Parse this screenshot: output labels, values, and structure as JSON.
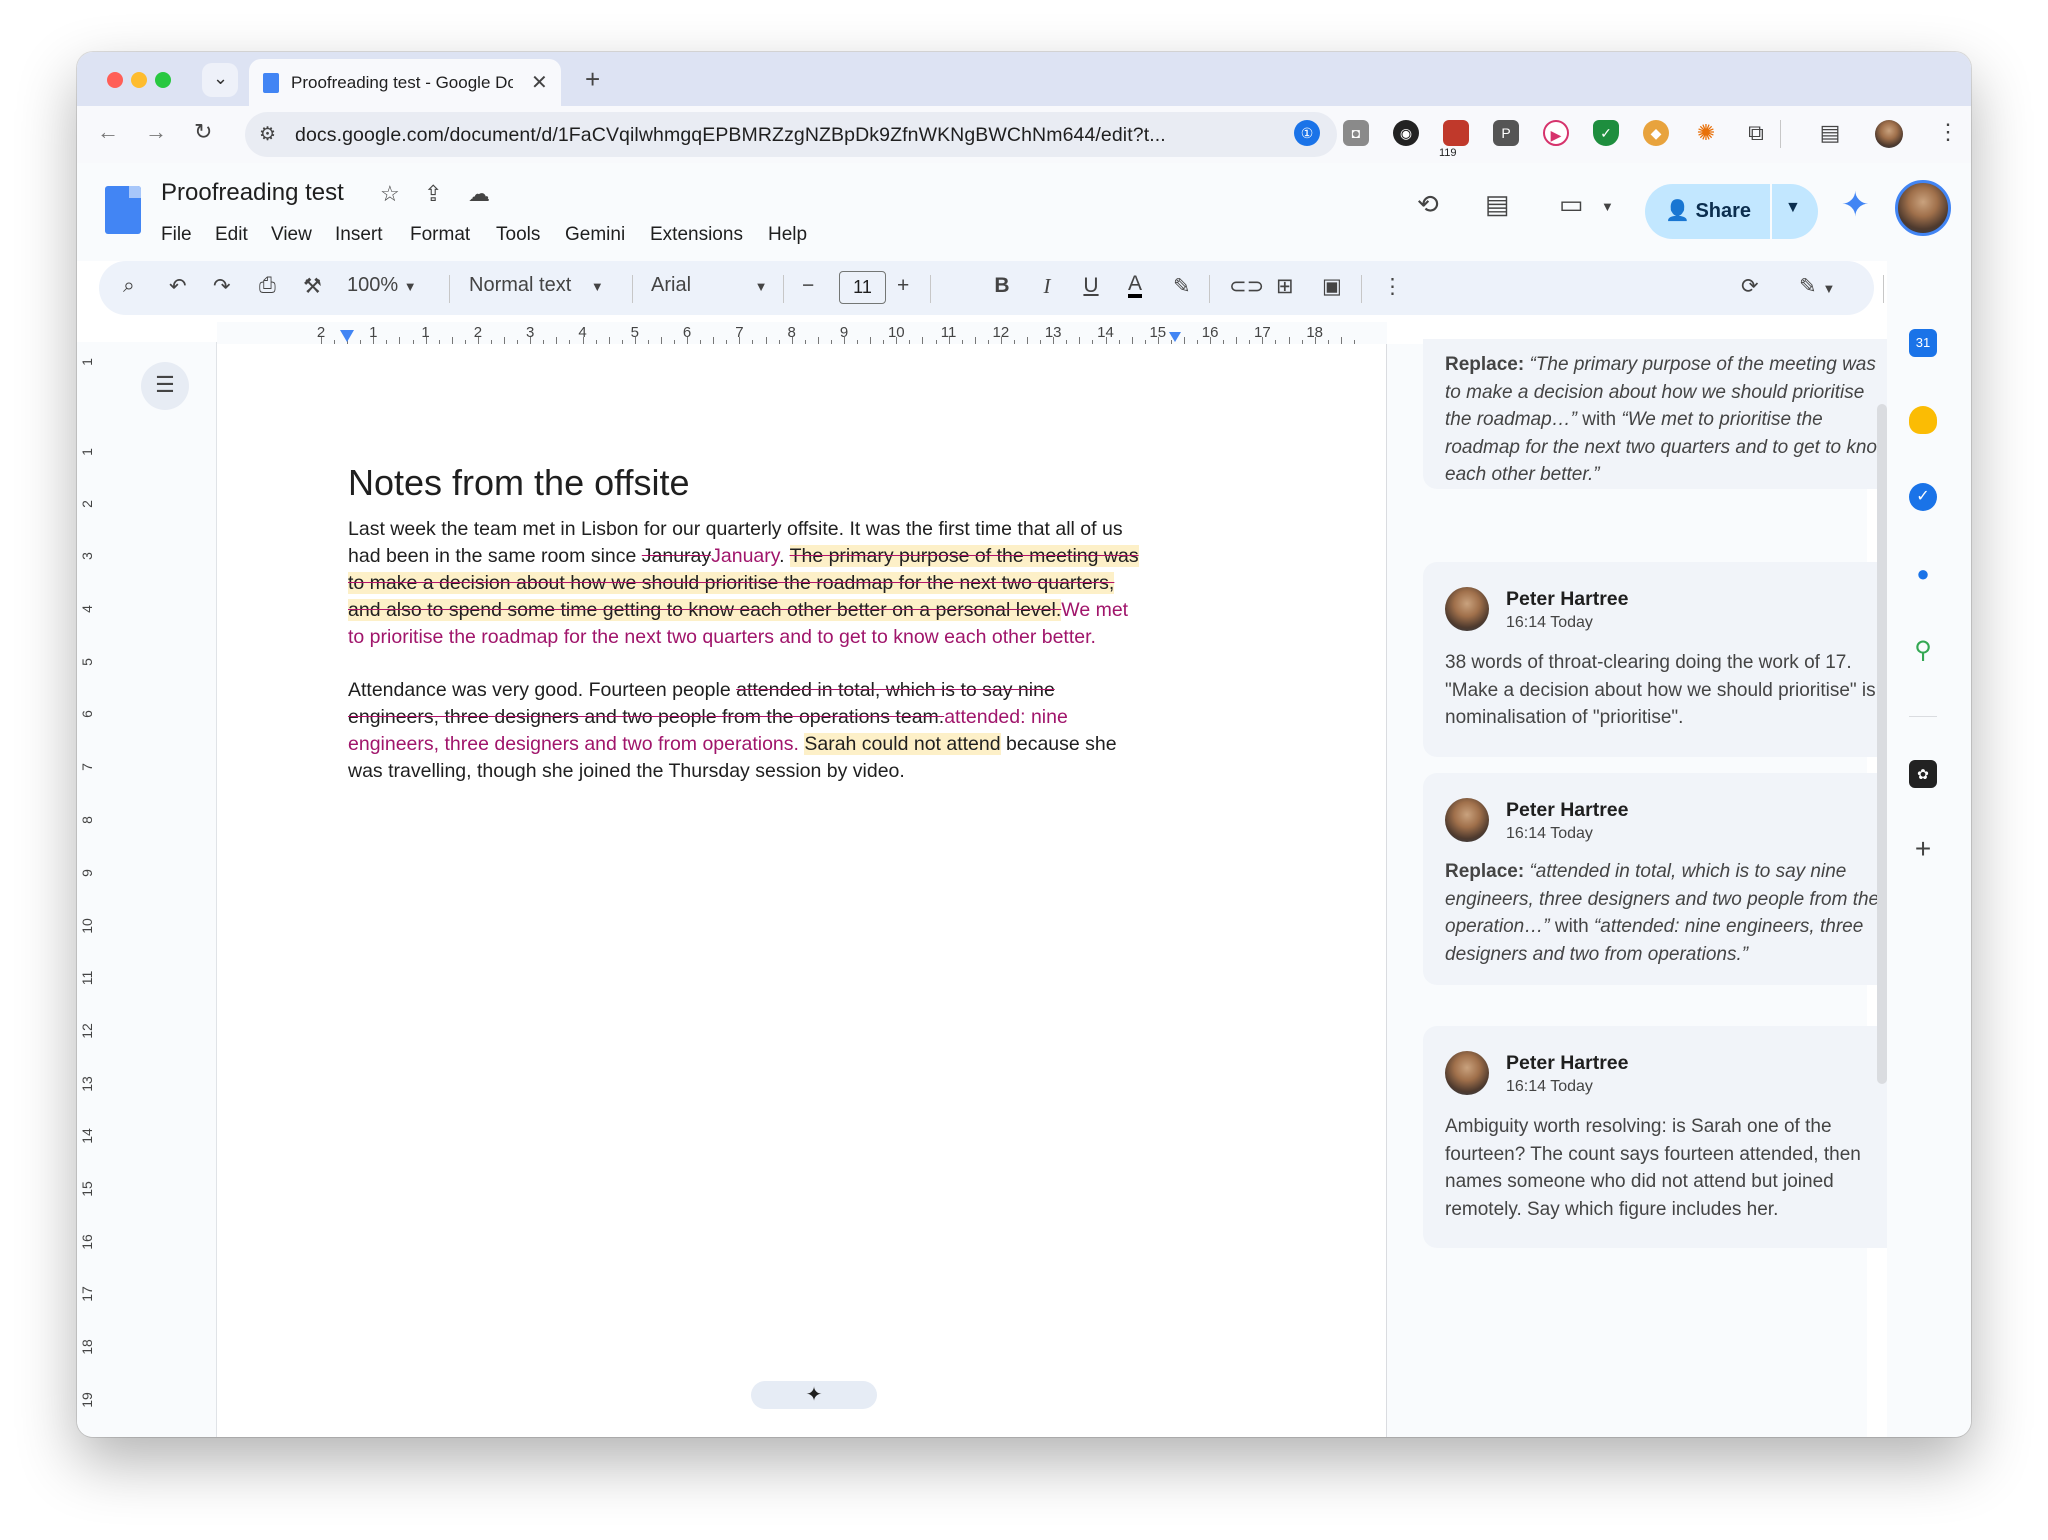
{
  "browser": {
    "tab_title": "Proofreading test - Google Docs",
    "url": "docs.google.com/document/d/1FaCVqilwhmgqEPBMRZzgNZBpDk9ZfnWKNgBWChNm644/edit?t...",
    "extension_badge": "119"
  },
  "doc": {
    "title": "Proofreading test",
    "menu": [
      "File",
      "Edit",
      "View",
      "Insert",
      "Format",
      "Tools",
      "Gemini",
      "Extensions",
      "Help"
    ],
    "share_label": "Share"
  },
  "toolbar": {
    "zoom": "100%",
    "style": "Normal text",
    "font": "Arial",
    "font_size": "11"
  },
  "ruler": {
    "h_labels": [
      "2",
      "1",
      "1",
      "2",
      "3",
      "4",
      "5",
      "6",
      "7",
      "8",
      "9",
      "10",
      "11",
      "12",
      "13",
      "14",
      "15",
      "16",
      "17",
      "18"
    ],
    "v_labels": [
      "1",
      "1",
      "2",
      "3",
      "4",
      "5",
      "6",
      "7",
      "8",
      "9",
      "10",
      "11",
      "12",
      "13",
      "14",
      "15",
      "16",
      "17",
      "18",
      "19"
    ]
  },
  "document": {
    "heading": "Notes from the offsite",
    "p1": {
      "a": "Last week the team met in Lisbon for our quarterly offsite. It was the first time that all of us had been in the same room since ",
      "del1": "Januray",
      "ins1": "January",
      "b": ". ",
      "del2": "The primary purpose of the meeting was to make a decision about how we should prioritise the roadmap for the next two quarters, and also to spend some time getting to know each other better on a personal level.",
      "ins2": "We met to prioritise the roadmap for the next two quarters and to get to know each other better."
    },
    "p2": {
      "a": "Attendance was very good. Fourteen people ",
      "del1": "attended in total, which is to say nine engineers, three designers and two people from the operations team.",
      "ins1": "attended: nine engineers, three designers and two from operations.",
      "b": " ",
      "hl": "Sarah could not attend",
      "c": " because she was travelling, though she joined the Thursday session by video."
    }
  },
  "comments": [
    {
      "replace_label": "Replace:",
      "replace_text": "“The primary purpose of the meeting was to make a decision about how we should prioritise the roadmap…”",
      "with_label": " with ",
      "with_text": "“We met to prioritise the roadmap for the next two quarters and to get to know each other better.”"
    },
    {
      "author": "Peter Hartree",
      "time": "16:14 Today",
      "body": "38 words of throat-clearing doing the work of 17. \"Make a decision about how we should prioritise\" is a nominalisation of \"prioritise\"."
    },
    {
      "author": "Peter Hartree",
      "time": "16:14 Today",
      "replace_label": "Replace:",
      "replace_text": "“attended in total, which is to say nine engineers, three designers and two people from the operation…”",
      "with_label": " with ",
      "with_text": "“attended: nine engineers, three designers and two from operations.”"
    },
    {
      "author": "Peter Hartree",
      "time": "16:14 Today",
      "body": "Ambiguity worth resolving: is Sarah one of the fourteen? The count says fourteen attended, then names someone who did not attend but joined remotely. Say which figure includes her."
    }
  ],
  "sidebar": {
    "calendar_badge": "31"
  },
  "colors": {
    "insertion": "#a0156b",
    "highlight": "#fdf0c8",
    "share_bg": "#c2e7ff",
    "docs_blue": "#4285f4"
  }
}
